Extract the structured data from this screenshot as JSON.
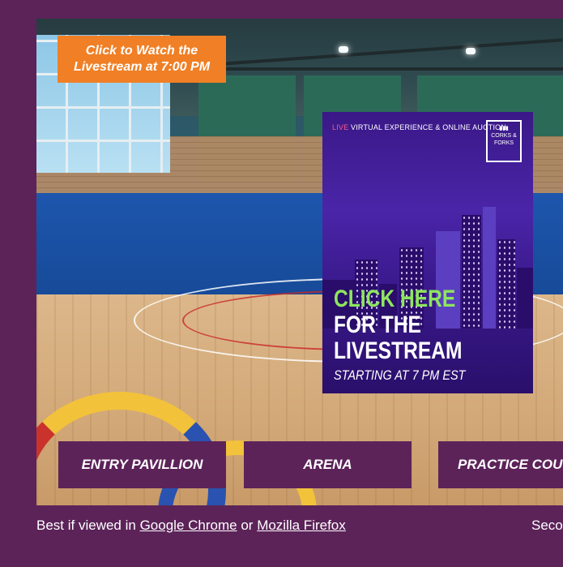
{
  "banner": {
    "line1": "Click to Watch the",
    "line2": "Livestream at 7:00 PM"
  },
  "poster": {
    "top_live": "LIVE",
    "top_text": "VIRTUAL EXPERIENCE & ONLINE AUCTION",
    "logo_text": "CORKS & FORKS",
    "headline_green": "CLICK HERE",
    "headline_line2": "FOR THE",
    "headline_line3": "LIVESTREAM",
    "sub": "STARTING AT 7 PM EST"
  },
  "nav": [
    {
      "label": "ENTRY PAVILLION"
    },
    {
      "label": "ARENA"
    },
    {
      "label": "PRACTICE COU"
    }
  ],
  "footer": {
    "prefix": "Best if viewed in",
    "link1": "Google Chrome",
    "middle": "or",
    "link2": "Mozilla Firefox",
    "right": "Seco"
  },
  "colors": {
    "page_bg": "#5c2359",
    "banner": "#f07f25",
    "poster": "#3a1887",
    "headline_accent": "#8ee65e"
  }
}
